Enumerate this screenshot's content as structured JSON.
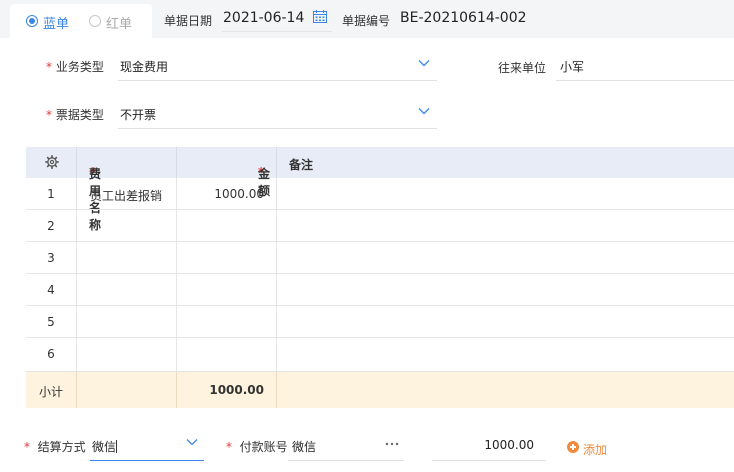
{
  "header": {
    "radio_options": [
      {
        "label": "蓝单",
        "selected": true
      },
      {
        "label": "红单",
        "selected": false
      }
    ],
    "date_label": "单据日期",
    "date_value": "2021-06-14",
    "number_label": "单据编号",
    "number_value": "BE-20210614-002"
  },
  "form": {
    "business_type": {
      "label": "业务类型",
      "value": "现金费用"
    },
    "counterparty": {
      "label": "往来单位",
      "value": "小军"
    },
    "invoice_type": {
      "label": "票据类型",
      "value": "不开票"
    }
  },
  "table": {
    "columns": [
      "费用名称",
      "金额",
      "备注"
    ],
    "rows": [
      {
        "index": "1",
        "name": "员工出差报销",
        "amount": "1000.00",
        "note": ""
      },
      {
        "index": "2",
        "name": "",
        "amount": "",
        "note": ""
      },
      {
        "index": "3",
        "name": "",
        "amount": "",
        "note": ""
      },
      {
        "index": "4",
        "name": "",
        "amount": "",
        "note": ""
      },
      {
        "index": "5",
        "name": "",
        "amount": "",
        "note": ""
      },
      {
        "index": "6",
        "name": "",
        "amount": "",
        "note": ""
      }
    ],
    "subtotal_label": "小计",
    "subtotal_amount": "1000.00"
  },
  "settlement": {
    "method_label": "结算方式",
    "method_value": "微信",
    "account_label": "付款账号",
    "account_value": "微信",
    "amount": "1000.00",
    "add_label": "添加"
  },
  "colors": {
    "accent_blue": "#3b86e6",
    "required_red": "#e03a3a",
    "add_orange": "#f08a3e",
    "subtotal_bg": "#fdf3df",
    "header_bg": "#e8ecf6"
  }
}
